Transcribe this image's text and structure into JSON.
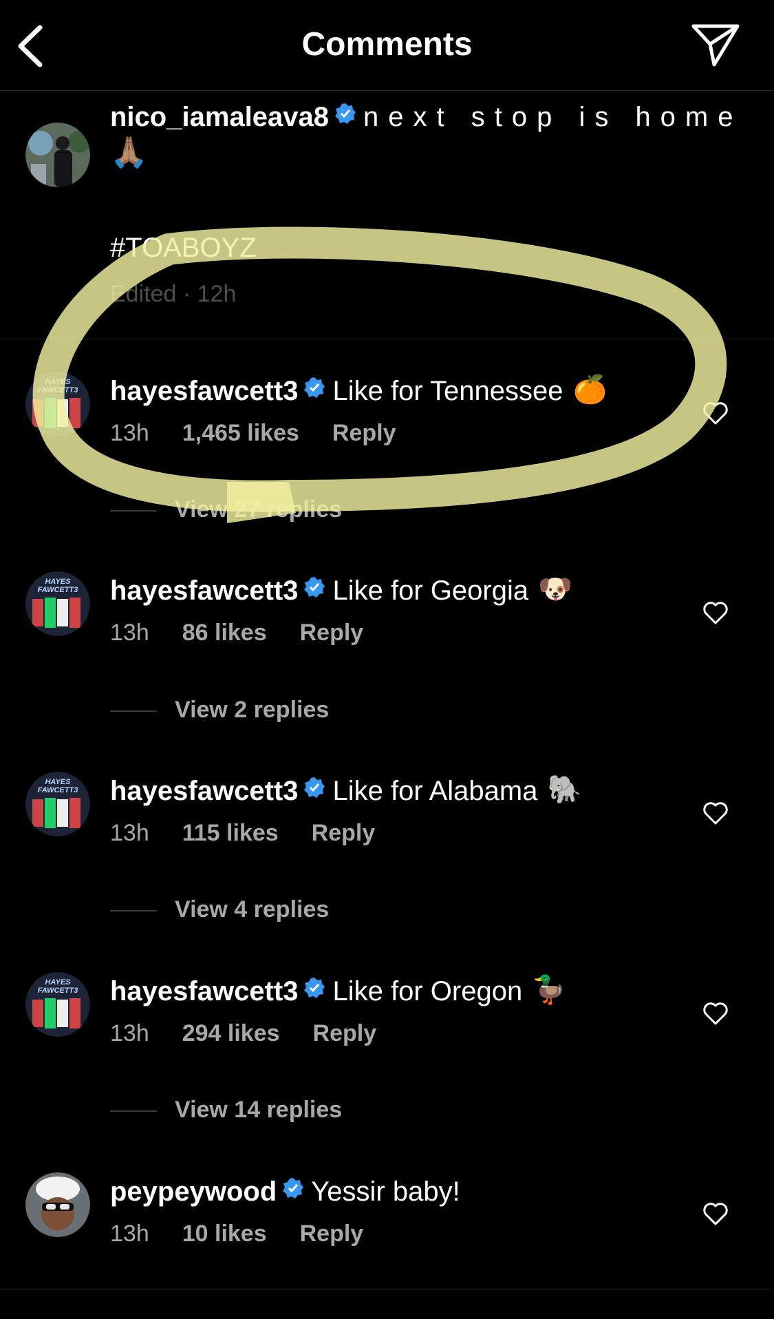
{
  "header": {
    "title": "Comments",
    "back_icon": "chevron-left-icon",
    "send_icon": "paper-plane-icon"
  },
  "caption": {
    "username": "nico_iamaleava8",
    "verified": true,
    "text": "next stop is home",
    "emoji": "🙏🏽",
    "hashtag": "#TOABOYZ",
    "meta": "Edited · 12h"
  },
  "comments": [
    {
      "username": "hayesfawcett3",
      "text": "Like for Tennessee",
      "emoji": "🍊",
      "time": "13h",
      "likes": "1,465 likes",
      "reply": "Reply",
      "view_replies": "View 27 replies"
    },
    {
      "username": "hayesfawcett3",
      "text": "Like for Georgia",
      "emoji": "🐶",
      "time": "13h",
      "likes": "86 likes",
      "reply": "Reply",
      "view_replies": "View 2 replies"
    },
    {
      "username": "hayesfawcett3",
      "text": "Like for Alabama",
      "emoji": "🐘",
      "time": "13h",
      "likes": "115 likes",
      "reply": "Reply",
      "view_replies": "View 4 replies"
    },
    {
      "username": "hayesfawcett3",
      "text": "Like for Oregon",
      "emoji": "🦆",
      "time": "13h",
      "likes": "294 likes",
      "reply": "Reply",
      "view_replies": "View 14 replies"
    },
    {
      "username": "peypeywood",
      "text": "Yessir baby!",
      "time": "13h",
      "likes": "10 likes",
      "reply": "Reply"
    }
  ],
  "colors": {
    "background": "#000000",
    "verified": "#3897f0",
    "meta_text": "#a8a8a8",
    "highlight": "#f2f0a0"
  }
}
